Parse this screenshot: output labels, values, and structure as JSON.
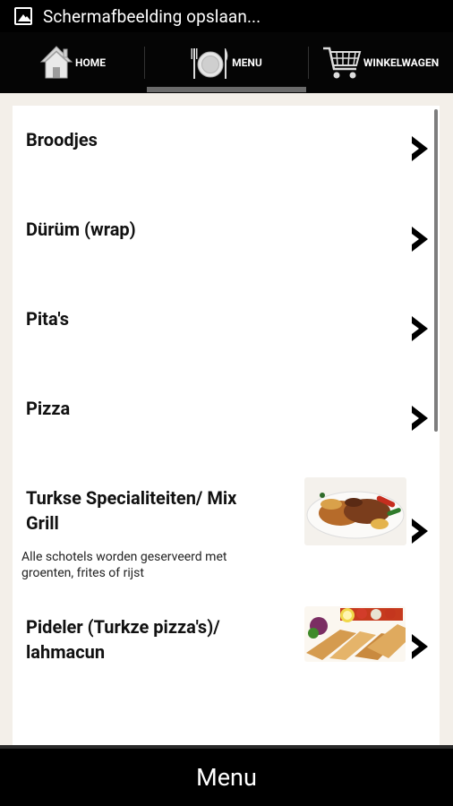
{
  "status_bar": {
    "notification_icon": "image-icon",
    "title": "Schermafbeelding opslaan..."
  },
  "tabs": [
    {
      "label": "HOME",
      "icon": "house-icon",
      "active": false
    },
    {
      "label": "MENU",
      "icon": "plate-cutlery-icon",
      "active": true
    },
    {
      "label": "WINKELWAGEN",
      "icon": "shopping-cart-icon",
      "active": false
    }
  ],
  "menu_items": [
    {
      "label": "Broodjes",
      "description": "",
      "has_image": false
    },
    {
      "label": "Dürüm (wrap)",
      "description": "",
      "has_image": false
    },
    {
      "label": "Pita's",
      "description": "",
      "has_image": false
    },
    {
      "label": "Pizza",
      "description": "",
      "has_image": false
    },
    {
      "label_line1": "Turkse Specialiteiten/ Mix",
      "label_line2": "Grill",
      "description_line1": "Alle schotels worden geserveerd met",
      "description_line2": "groenten, frites of rijst",
      "has_image": true
    },
    {
      "label_line1": "Pideler (Turkze pizza's)/",
      "label_line2": "lahmacun",
      "description": "",
      "has_image": true
    }
  ],
  "bottom_bar": {
    "title": "Menu"
  }
}
